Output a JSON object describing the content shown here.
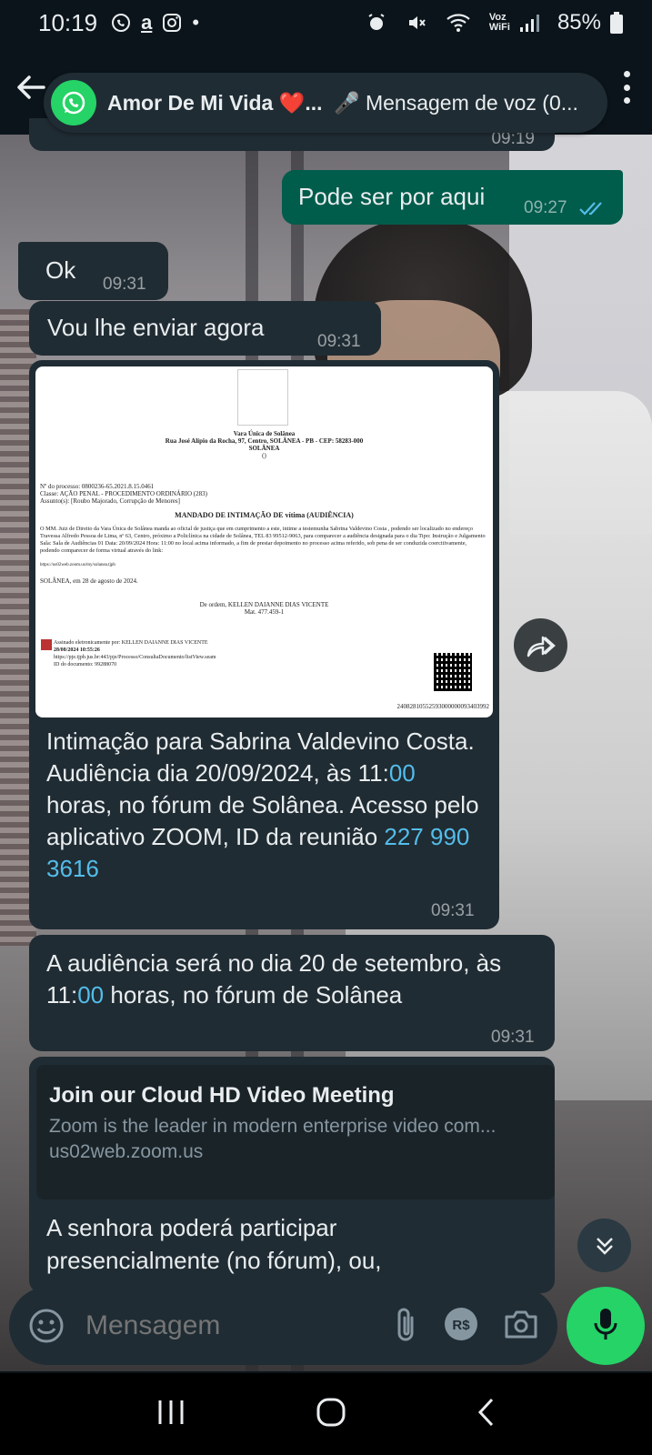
{
  "status_bar": {
    "time": "10:19",
    "net_label": "Voz\nWiFi",
    "battery": "85%"
  },
  "header": {
    "contact_name": "Amor De Mi Vida ❤️...",
    "audio_note": "🎤 Mensagem de voz (0...",
    "prev_time": "09:19"
  },
  "messages": [
    {
      "dir": "out",
      "text": "Pode ser por aqui",
      "time": "09:27"
    },
    {
      "dir": "in",
      "text": "Ok",
      "time": "09:31"
    },
    {
      "dir": "in",
      "text": "Vou lhe enviar agora",
      "time": "09:31"
    },
    {
      "dir": "in",
      "doc": {
        "court": "Vara Única de Solânea",
        "address": "Rua José Alípio da Rocha, 97, Centro, SOLÂNEA - PB - CEP: 58283-000",
        "city": "SOLÂNEA",
        "zero": "()",
        "process_no": "Nº do processo: 0800236-65.2021.8.15.0461",
        "class": "Classe: AÇÃO PENAL - PROCEDIMENTO ORDINÁRIO (283)",
        "subject": "Assunto(s): [Roubo Majorado, Corrupção de Menores]",
        "heading": "MANDADO DE INTIMAÇÃO DE vítima (AUDIÊNCIA)",
        "body": "O MM. Juiz de Direito da Vara Única de Solânea manda ao oficial de justiça que em cumprimento a este, intime a testemunha Sabrina Valdevino Costa , podendo ser localizado no endereço Travessa Alfredo Pessoa de Lima, nº 63, Centro, próximo a Policlínica na cidade de Solânea, TEL 83 99512-9063, para comparecer a audiência designada para o dia Tipo: Instrução e Julgamento Sala: Sala de Audiências 01 Data: 20/09/2024 Hora: 11:00 no local acima informado, a fim de prestar depoimento no processo acima referido, sob pena de ser conduzida coercitivamente, podendo comparecer de forma virtual através do link:",
        "link": "https://us02web.zoom.us/my/solanea.tjpb",
        "date_line": "SOLÂNEA, em 28 de agosto de 2024.",
        "order": "De ordem, KELLEN DAIANNE DIAS VICENTE",
        "mat": "Mat. 477.459-1",
        "signed": "Assinado eletronicamente por: KELLEN DAIANNE DIAS VICENTE",
        "signed_date": "28/08/2024 10:55:26",
        "pje_url": "https://pje.tjpb.jus.br:443/pje/Processo/ConsultaDocumento/listView.seam",
        "doc_id": "ID do documento: 99288070",
        "barcode_no": "24082810552593000000093403992"
      },
      "caption_a": "Intimação para Sabrina Valdevino Costa. Audiência dia 20/09/2024, às 11:",
      "caption_link1": "00",
      "caption_b": " horas, no fórum de Solânea. Acesso pelo aplicativo ZOOM, ID da reunião ",
      "caption_link2": "227 990 3616",
      "time": "09:31"
    },
    {
      "dir": "in",
      "text_a": "A audiência será no dia 20 de setembro, às 11:",
      "text_link": "00",
      "text_b": " horas, no fórum de Solânea",
      "time": "09:31"
    },
    {
      "dir": "in",
      "preview": {
        "title": "Join our Cloud HD Video Meeting",
        "desc": "Zoom is the leader in modern enterprise video com...",
        "url": "us02web.zoom.us"
      },
      "text": "A senhora poderá participar presencialmente (no fórum), ou,"
    }
  ],
  "composer": {
    "placeholder": "Mensagem"
  }
}
